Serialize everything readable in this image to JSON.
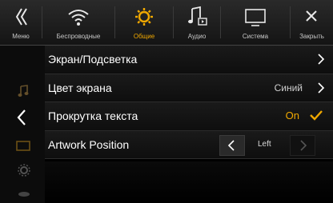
{
  "topbar": {
    "menu_label": "Меню",
    "close_label": "Закрыть",
    "tabs": [
      {
        "label": "Беспроводные",
        "icon": "wireless-icon"
      },
      {
        "label": "Общие",
        "icon": "gear-icon",
        "active": true
      },
      {
        "label": "Аудио",
        "icon": "audio-icon"
      },
      {
        "label": "Система",
        "icon": "system-monitor-icon"
      }
    ]
  },
  "colors": {
    "accent": "#f0a800",
    "background": "#000000",
    "topbar": "#1e1e1e"
  },
  "settings": [
    {
      "title": "Экран/Подсветка",
      "value": "",
      "control": "chevron"
    },
    {
      "title": "Цвет экрана",
      "value": "Синий",
      "control": "chevron"
    },
    {
      "title": "Прокрутка текста",
      "value": "On",
      "control": "checkbox"
    },
    {
      "title": "Artwork Position",
      "value": "Left",
      "control": "stepper"
    }
  ]
}
